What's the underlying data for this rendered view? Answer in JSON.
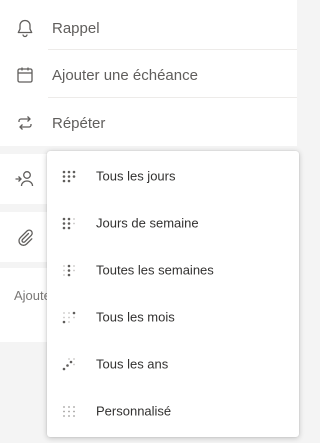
{
  "details": {
    "reminder_label": "Rappel",
    "due_date_label": "Ajouter une échéance",
    "repeat_label": "Répéter",
    "note_placeholder": "Ajouter une note"
  },
  "repeat_menu": {
    "items": [
      {
        "label": "Tous les jours",
        "icon": "daily-icon"
      },
      {
        "label": "Jours de semaine",
        "icon": "weekdays-icon"
      },
      {
        "label": "Toutes les semaines",
        "icon": "weekly-icon"
      },
      {
        "label": "Tous les mois",
        "icon": "monthly-icon"
      },
      {
        "label": "Tous les ans",
        "icon": "yearly-icon"
      },
      {
        "label": "Personnalisé",
        "icon": "custom-icon"
      }
    ]
  },
  "colors": {
    "text": "#323130",
    "muted_text": "#605e5c",
    "icon": "#605e5c",
    "background": "#f4f4f4",
    "card": "#ffffff"
  }
}
